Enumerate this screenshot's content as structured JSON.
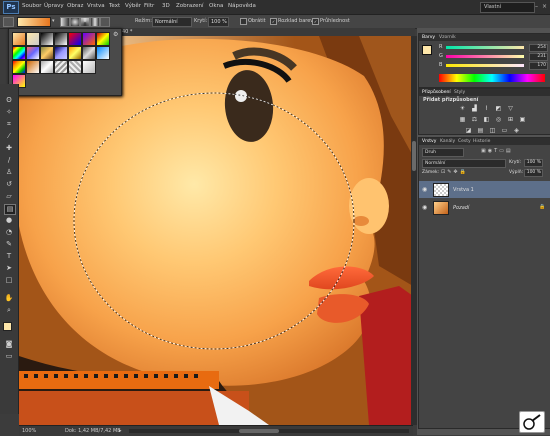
{
  "app": {
    "logo": "Ps"
  },
  "menu": [
    "Soubor",
    "Úpravy",
    "Obraz",
    "Vrstva",
    "Text",
    "Výběr",
    "Filtr",
    "3D",
    "Zobrazení",
    "Okna",
    "Nápověda"
  ],
  "workspace": "Vlastní",
  "options": {
    "mode_label": "Režim:",
    "mode_value": "Normální",
    "opacity_label": "Krytí:",
    "opacity_value": "100 %",
    "reverse_label": "Obrátit",
    "dither_label": "Rozklad barev",
    "transparency_label": "Průhlednost"
  },
  "document": {
    "tab": "CR40 *"
  },
  "status": {
    "zoom": "100%",
    "doc_info": "Dok: 1,42 MB/7,42 MB"
  },
  "color_panel": {
    "tabs": [
      "Barvy",
      "Vzorník"
    ],
    "r": {
      "label": "R",
      "value": "254"
    },
    "g": {
      "label": "G",
      "value": "231"
    },
    "b": {
      "label": "B",
      "value": "170"
    }
  },
  "adjust_panel": {
    "tabs": [
      "Přizpůsobení",
      "Styly"
    ],
    "title": "Přidat přizpůsobení"
  },
  "layers_panel": {
    "tabs": [
      "Vrstvy",
      "Kanály",
      "Cesty",
      "Historie"
    ],
    "kind": "Druh",
    "blend": "Normální",
    "opacity_label": "Krytí:",
    "opacity_value": "100 %",
    "lock_label": "Zámek:",
    "fill_label": "Výplň:",
    "fill_value": "100 %",
    "layers": [
      {
        "name": "Vrstva 1"
      },
      {
        "name": "Pozadí"
      }
    ]
  },
  "icons": {
    "brush_tool_badge": "paintbrush-icon"
  },
  "colors": {
    "foreground": "#fee7aa",
    "background": "#e8761e"
  }
}
